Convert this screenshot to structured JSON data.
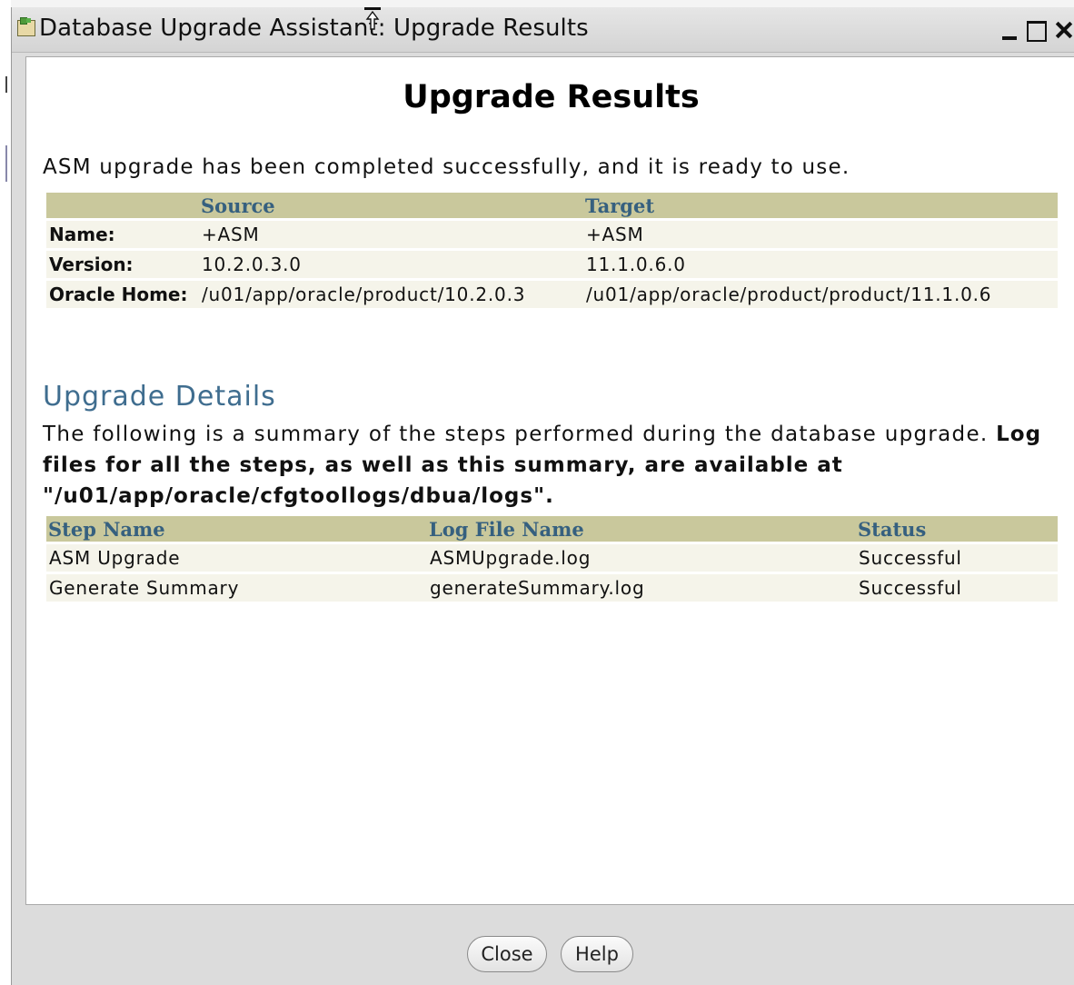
{
  "window": {
    "title": "Database Upgrade Assistant: Upgrade Results"
  },
  "heading": "Upgrade Results",
  "intro": "ASM upgrade has been completed successfully, and it is ready to use.",
  "results_table": {
    "headers": [
      "",
      "Source",
      "Target"
    ],
    "rows": [
      {
        "label": "Name:",
        "source": "+ASM",
        "target": "+ASM"
      },
      {
        "label": "Version:",
        "source": "10.2.0.3.0",
        "target": "11.1.0.6.0"
      },
      {
        "label": "Oracle Home:",
        "source": "/u01/app/oracle/product/10.2.0.3",
        "target": "/u01/app/oracle/product/product/11.1.0.6"
      }
    ]
  },
  "details": {
    "title": "Upgrade Details",
    "text": "The following is a summary of the steps performed during the database upgrade.",
    "bold_text": "Log files for all the steps, as well as this summary, are available at \"/u01/app/oracle/cfgtoollogs/dbua/logs\"."
  },
  "steps_table": {
    "headers": [
      "Step Name",
      "Log File Name",
      "Status"
    ],
    "rows": [
      {
        "step": "ASM Upgrade",
        "log": "ASMUpgrade.log",
        "status": "Successful"
      },
      {
        "step": "Generate Summary",
        "log": "generateSummary.log",
        "status": "Successful"
      }
    ]
  },
  "buttons": {
    "close": "Close",
    "help": "Help"
  },
  "icons": {
    "app": "dbua-app-icon",
    "cursor": "mouse-cursor-icon",
    "minimize": "minimize-icon",
    "maximize": "maximize-icon",
    "close": "close-icon"
  },
  "colors": {
    "table_header_bg": "#c9c89c",
    "table_header_text": "#36607f",
    "row_bg": "#f5f4ea",
    "section_title": "#3f6d8f"
  }
}
